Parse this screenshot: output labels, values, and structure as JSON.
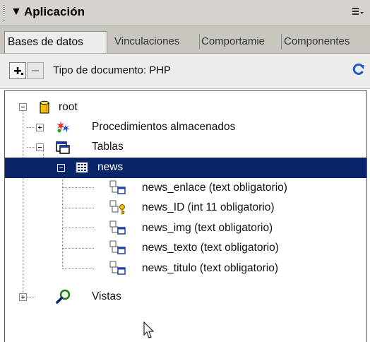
{
  "panel": {
    "title": "Aplicación",
    "tabs": [
      {
        "label": "Bases de datos",
        "active": true
      },
      {
        "label": "Vinculaciones",
        "active": false
      },
      {
        "label": "Comportamie",
        "active": false
      },
      {
        "label": "Componentes",
        "active": false
      }
    ]
  },
  "toolbar": {
    "add_label": "+",
    "remove_label": "−",
    "doc_type": "Tipo de documento: PHP",
    "refresh_icon": "refresh-icon"
  },
  "tree": {
    "root": {
      "label": "root",
      "icon": "database-icon"
    },
    "procedures": {
      "label": "Procedimientos almacenados",
      "icon": "stored-procedure-icon"
    },
    "tables": {
      "label": "Tablas",
      "icon": "table-group-icon"
    },
    "news": {
      "label": "news",
      "icon": "table-icon",
      "selected": true
    },
    "columns": [
      {
        "label": "news_enlace (text obligatorio)",
        "icon": "column-icon"
      },
      {
        "label": "news_ID (int 11 obligatorio)",
        "icon": "primary-key-column-icon"
      },
      {
        "label": "news_img (text obligatorio)",
        "icon": "column-icon"
      },
      {
        "label": "news_texto (text obligatorio)",
        "icon": "column-icon"
      },
      {
        "label": "news_titulo (text obligatorio)",
        "icon": "column-icon"
      }
    ],
    "views": {
      "label": "Vistas",
      "icon": "view-icon"
    }
  },
  "colors": {
    "selection": "#0a246a",
    "chrome": "#d6d3ce",
    "refresh": "#1f5fc4"
  }
}
